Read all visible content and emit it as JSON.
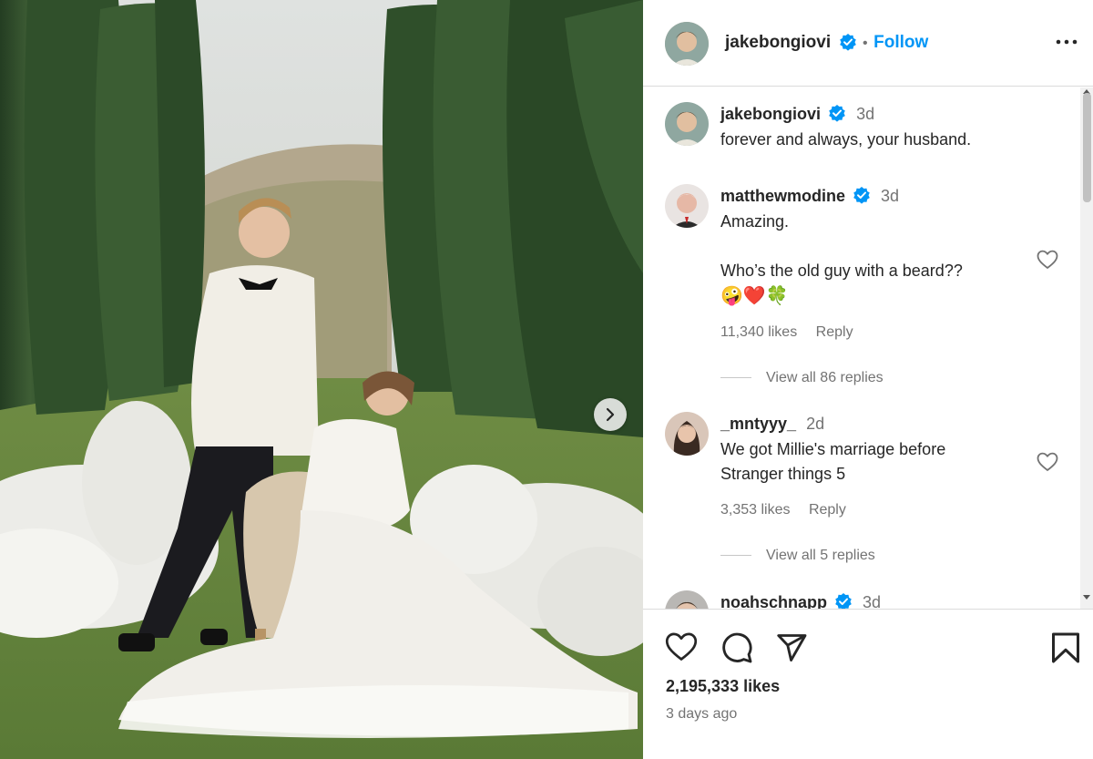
{
  "post": {
    "author": "jakebongiovi",
    "follow_label": "Follow",
    "separator": "•"
  },
  "caption": {
    "user": "jakebongiovi",
    "time": "3d",
    "text": "forever and always, your husband."
  },
  "comments": [
    {
      "user": "matthewmodine",
      "time": "3d",
      "lines": [
        "Amazing.",
        "",
        "Who’s the old guy with a beard??",
        "🤪❤️🍀"
      ],
      "likes": "11,340 likes",
      "reply": "Reply",
      "view_replies": "View all 86 replies"
    },
    {
      "user": "_mntyyy_",
      "time": "2d",
      "lines": [
        "We got Millie's marriage before",
        "Stranger things 5"
      ],
      "likes": "3,353 likes",
      "reply": "Reply",
      "view_replies": "View all 5 replies"
    },
    {
      "user": "noahschnapp",
      "time": "3d"
    }
  ],
  "footer": {
    "likes": "2,195,333 likes",
    "date": "3 days ago"
  },
  "icons": {
    "verified": "verified-badge-icon",
    "more": "more-options-icon",
    "like": "heart-icon",
    "comment": "comment-icon",
    "share": "share-icon",
    "save": "bookmark-icon",
    "next": "chevron-right-icon"
  },
  "colors": {
    "accent": "#0095f6",
    "verified": "#0095f6",
    "muted": "#737373",
    "text": "#262626"
  }
}
